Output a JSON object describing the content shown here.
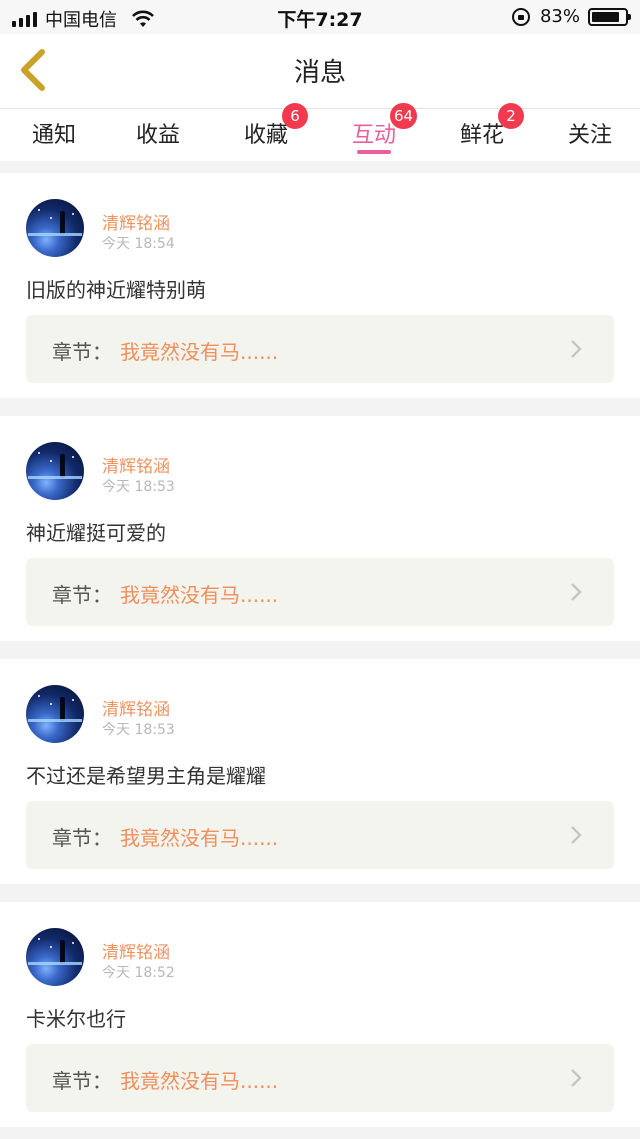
{
  "status_bar": {
    "carrier": "中国电信",
    "time": "下午7:27",
    "battery": "83%",
    "battery_level": 0.83
  },
  "nav": {
    "title": "消息",
    "back_icon": "chevron-left-icon",
    "back_color": "#c9a227"
  },
  "tabs": [
    {
      "label": "通知",
      "badge": ""
    },
    {
      "label": "收益",
      "badge": ""
    },
    {
      "label": "收藏",
      "badge": "6"
    },
    {
      "label": "互动",
      "badge": "64",
      "active": true
    },
    {
      "label": "鲜花",
      "badge": "2"
    },
    {
      "label": "关注",
      "badge": ""
    }
  ],
  "colors": {
    "accent": "#e8609a",
    "badge": "#f2394e",
    "username": "#f0925e",
    "chapter_title": "#f08f5c"
  },
  "messages": [
    {
      "user": "清辉铭涵",
      "time": "今天 18:54",
      "text": "旧版的神近耀特别萌",
      "chapter_label": "章节：",
      "chapter_title": "我竟然没有马......"
    },
    {
      "user": "清辉铭涵",
      "time": "今天 18:53",
      "text": "神近耀挺可爱的",
      "chapter_label": "章节：",
      "chapter_title": "我竟然没有马......"
    },
    {
      "user": "清辉铭涵",
      "time": "今天 18:53",
      "text": "不过还是希望男主角是耀耀",
      "chapter_label": "章节：",
      "chapter_title": "我竟然没有马......"
    },
    {
      "user": "清辉铭涵",
      "time": "今天 18:52",
      "text": "卡米尔也行",
      "chapter_label": "章节：",
      "chapter_title": "我竟然没有马......"
    }
  ]
}
